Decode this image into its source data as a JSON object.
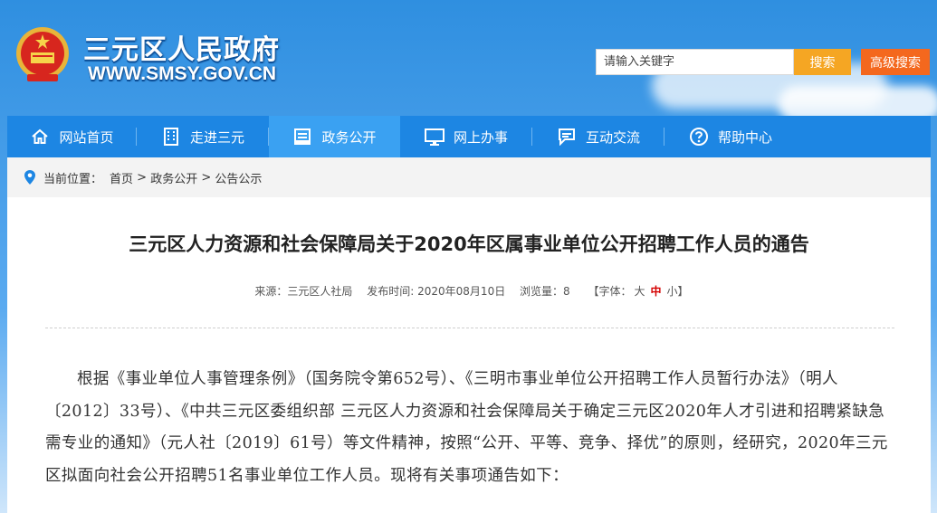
{
  "header": {
    "site_name": "三元区人民政府",
    "site_url": "WWW.SMSY.GOV.CN",
    "search_placeholder": "请输入关键字",
    "search_label": "搜索",
    "advanced_search_label": "高级搜索"
  },
  "nav": {
    "items": [
      {
        "label": "网站首页",
        "icon": "home-icon"
      },
      {
        "label": "走进三元",
        "icon": "building-icon"
      },
      {
        "label": "政务公开",
        "icon": "document-icon"
      },
      {
        "label": "网上办事",
        "icon": "monitor-icon"
      },
      {
        "label": "互动交流",
        "icon": "chat-icon"
      },
      {
        "label": "帮助中心",
        "icon": "help-icon"
      }
    ],
    "active_index": 2
  },
  "breadcrumb": {
    "prefix": "当前位置：",
    "items": [
      "首页",
      "政务公开",
      "公告公示"
    ],
    "separator": " > "
  },
  "article": {
    "title": "三元区人力资源和社会保障局关于2020年区属事业单位公开招聘工作人员的通告",
    "source_label": "来源：三元区人社局",
    "date_label": "发布时间: 2020年08月10日",
    "views_label": "浏览量：8",
    "font_prefix": "【字体：",
    "font_large": "大",
    "font_medium": "中",
    "font_small": "小】",
    "body": "根据《事业单位人事管理条例》（国务院令第652号）、《三明市事业单位公开招聘工作人员暂行办法》（明人〔2012〕33号）、《中共三元区委组织部 三元区人力资源和社会保障局关于确定三元区2020年人才引进和招聘紧缺急需专业的通知》（元人社〔2019〕61号）等文件精神，按照“公开、平等、竞争、择优”的原则，经研究，2020年三元区拟面向社会公开招聘51名事业单位工作人员。现将有关事项通告如下："
  },
  "colors": {
    "nav_bg": "#1d86e3",
    "nav_active": "#3aa1f2",
    "search_btn": "#f5a623",
    "adv_btn": "#f4681e"
  }
}
